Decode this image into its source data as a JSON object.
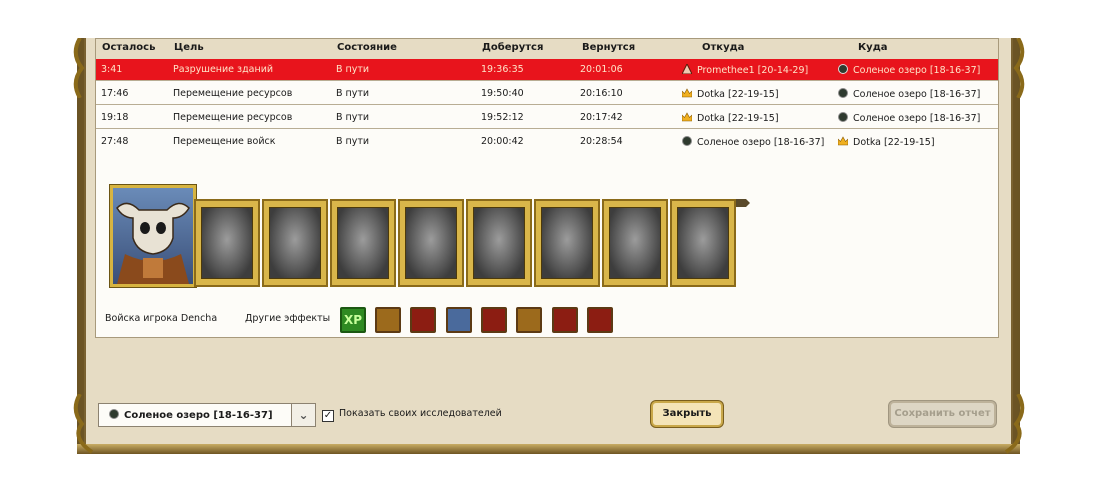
{
  "table": {
    "headers": {
      "remaining": "Осталось",
      "goal": "Цель",
      "state": "Состояние",
      "arrive": "Доберутся",
      "return": "Вернутся",
      "from": "Откуда",
      "to": "Куда"
    },
    "rows": [
      {
        "remaining": "3:41",
        "goal": "Разрушение зданий",
        "state": "В пути",
        "arrive": "19:36:35",
        "return": "20:01:06",
        "from": "Promethee1 [20-14-29]",
        "from_icon": "hostile-castle-icon",
        "to": "Соленое озеро [18-16-37]",
        "to_icon": "own-castle-icon",
        "hostile": true
      },
      {
        "remaining": "17:46",
        "goal": "Перемещение ресурсов",
        "state": "В пути",
        "arrive": "19:50:40",
        "return": "20:16:10",
        "from": "Dotka [22-19-15]",
        "from_icon": "crown-icon",
        "to": "Соленое озеро [18-16-37]",
        "to_icon": "own-castle-icon",
        "hostile": false
      },
      {
        "remaining": "19:18",
        "goal": "Перемещение ресурсов",
        "state": "В пути",
        "arrive": "19:52:12",
        "return": "20:17:42",
        "from": "Dotka [22-19-15]",
        "from_icon": "crown-icon",
        "to": "Соленое озеро [18-16-37]",
        "to_icon": "own-castle-icon",
        "hostile": false
      },
      {
        "remaining": "27:48",
        "goal": "Перемещение войск",
        "state": "В пути",
        "arrive": "20:00:42",
        "return": "20:28:54",
        "from": "Соленое озеро [18-16-37]",
        "from_icon": "own-castle-icon",
        "to": "Dotka [22-19-15]",
        "to_icon": "crown-icon",
        "hostile": false
      }
    ]
  },
  "army": {
    "label": "Войска игрока Dencha",
    "hero_icon": "skull-hero-portrait",
    "units": [
      "knight-unit",
      "dwarf-unit",
      "rider-unit",
      "griffin-unit",
      "archer-unit",
      "cleric-unit",
      "golem-unit",
      "horseman-unit"
    ]
  },
  "effects": {
    "label": "Другие эффекты",
    "items": [
      {
        "icon": "xp-icon",
        "text": "XP",
        "style": "xp"
      },
      {
        "icon": "gold-shield-icon",
        "style": "gold"
      },
      {
        "icon": "red-sword-icon",
        "style": "red"
      },
      {
        "icon": "blue-sword-icon",
        "style": "blue"
      },
      {
        "icon": "red-sword-icon",
        "style": "red"
      },
      {
        "icon": "gold-shield-icon",
        "style": "gold"
      },
      {
        "icon": "red-sword-icon",
        "style": "red"
      },
      {
        "icon": "red-sword-icon",
        "style": "red"
      }
    ]
  },
  "footer": {
    "location_value": "Соленое озеро [18-16-37]",
    "show_explorers_label": "Показать своих исследователей",
    "show_explorers_checked": true,
    "close_label": "Закрыть",
    "save_label": "Сохранить отчет"
  },
  "colors": {
    "hostile_row": "#e8141c",
    "frame_gold": "#d7b441",
    "panel_bg": "#e6dcc4"
  }
}
